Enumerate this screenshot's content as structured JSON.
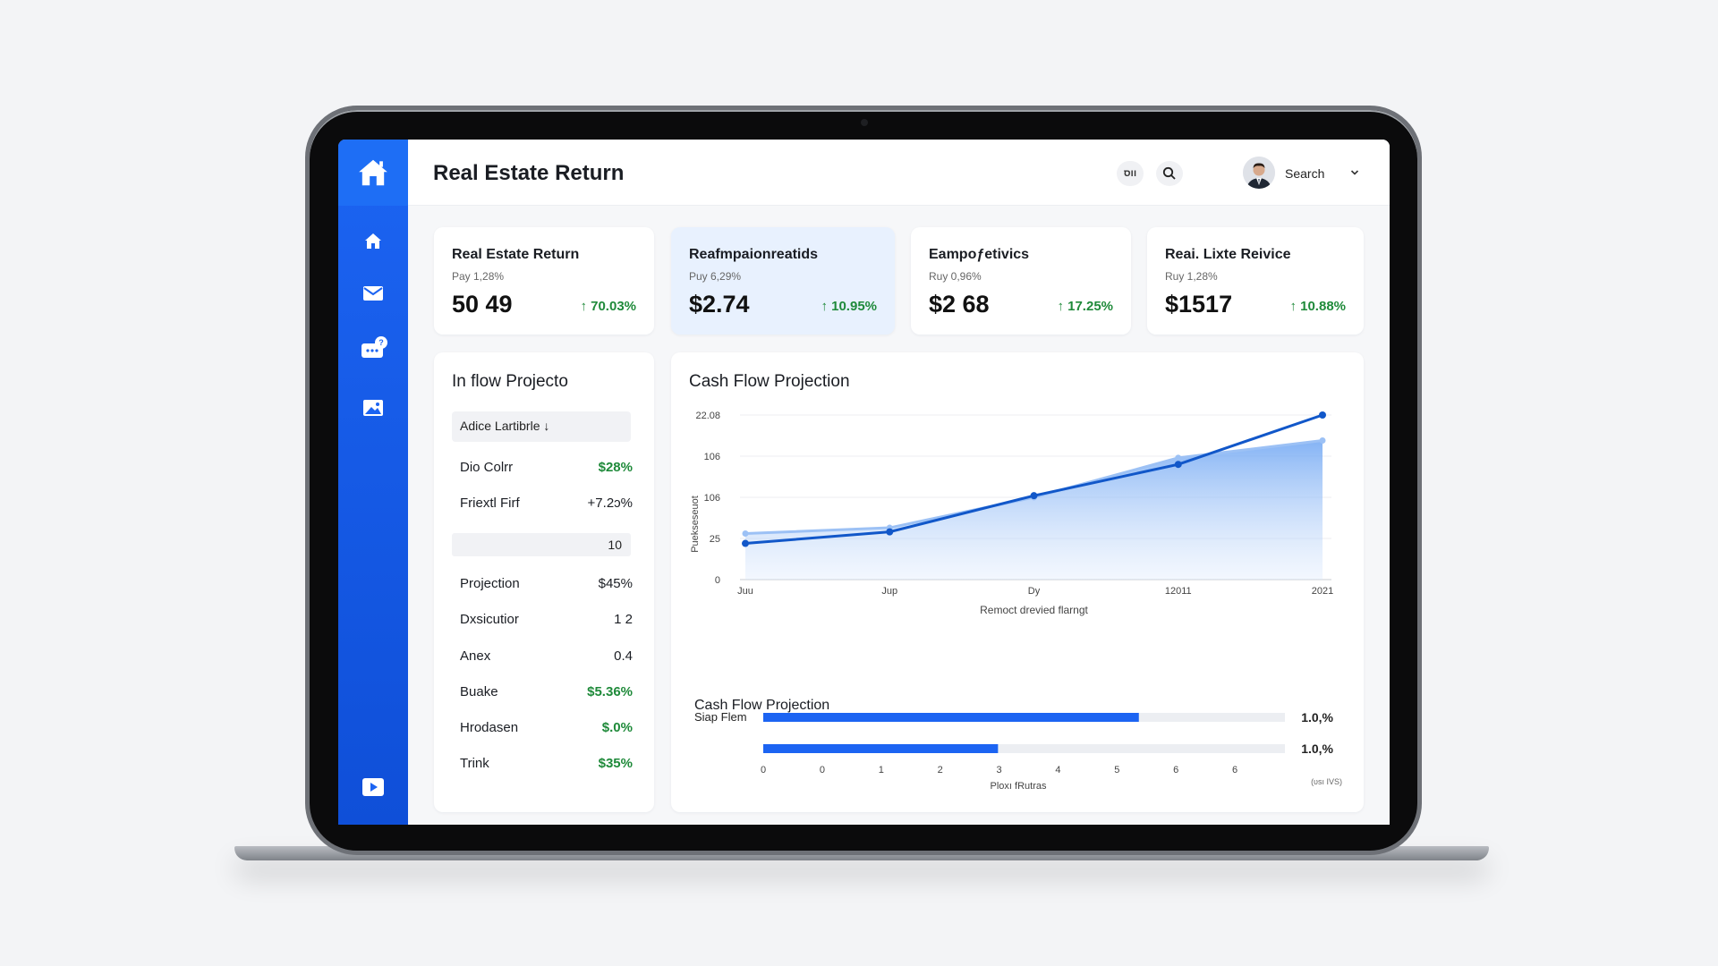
{
  "app": {
    "title": "Real Estate Return"
  },
  "header": {
    "chip_label": "ווס",
    "user_label": "Search"
  },
  "colors": {
    "accent": "#1c64f2",
    "positive": "#1f8a3a",
    "line_primary": "#1157c9",
    "line_secondary": "#9cc1f5"
  },
  "sidebar": {
    "icons": [
      "home-logo-icon",
      "home-icon",
      "mail-icon",
      "chat-icon",
      "image-icon",
      "play-icon"
    ],
    "badge": "?"
  },
  "stats": [
    {
      "title": "Real Estate Return",
      "sub": "Pay 1,28%",
      "value": "50 49",
      "change": "↑ 70.03%"
    },
    {
      "title": "Reafmpaionreatids",
      "sub": "Puy 6,29%",
      "value": "$2.74",
      "change": "↑ 10.95%"
    },
    {
      "title": "Eampoƒetivics",
      "sub": "Ruy 0,96%",
      "value": "$2 68",
      "change": "↑ 17.25%"
    },
    {
      "title": "Reai. Lixte Reivice",
      "sub": "Ruy 1,28%",
      "value": "$1517",
      "change": "↑ 10.88%"
    }
  ],
  "left_panel": {
    "title": "In flow Projecto",
    "select": "Adice Lartibrle ↓",
    "input_value": "10",
    "rows": [
      {
        "label": "Dio Colrr",
        "value": "$28%",
        "style": "green"
      },
      {
        "label": "Friextl Firf",
        "value": "+7.2ɔ%",
        "style": "plain"
      },
      {
        "label": "Projection",
        "value": "$45%",
        "style": "plain"
      },
      {
        "label": "Dxsicutior",
        "value": "1 2",
        "style": "plain"
      },
      {
        "label": "Anex",
        "value": "0.4",
        "style": "plain"
      },
      {
        "label": "Buake",
        "value": "$5.36%",
        "style": "green"
      },
      {
        "label": "Hrodasen",
        "value": "$.0%",
        "style": "green"
      },
      {
        "label": "Trink",
        "value": "$35%",
        "style": "green"
      }
    ]
  },
  "chart_panel": {
    "title": "Cash Flow Projection",
    "bars_title": "Cash Flow Projection"
  },
  "chart_data": [
    {
      "type": "area",
      "title": "Cash Flow Projection",
      "xlabel": "Remoct drevied flarngt",
      "ylabel": "Puekseseuot",
      "categories": [
        "Juu",
        "Jup",
        "Dy",
        "12011",
        "2021"
      ],
      "y_tick_labels": [
        "0",
        "25",
        "106",
        "106",
        "22.08"
      ],
      "ylim": [
        0,
        200
      ],
      "grid": true,
      "series": [
        {
          "values": [
            44,
            58,
            102,
            140,
            200
          ]
        },
        {
          "values": [
            56,
            63,
            100,
            148,
            169
          ]
        }
      ]
    },
    {
      "type": "bar",
      "title": "Cash Flow Projection",
      "xlabel": "Ploxı fRutras",
      "orientation": "horizontal",
      "x_tick_labels": [
        "0",
        "0",
        "1",
        "2",
        "3",
        "4",
        "5",
        "6",
        "6"
      ],
      "xlim": [
        0,
        1
      ],
      "side_note": "(υsı IVS)",
      "bars": [
        {
          "label": "Siap Flem",
          "value": 0.72,
          "value_label": "1.0,%"
        },
        {
          "label": "",
          "value": 0.45,
          "value_label": "1.0,%"
        }
      ]
    }
  ]
}
